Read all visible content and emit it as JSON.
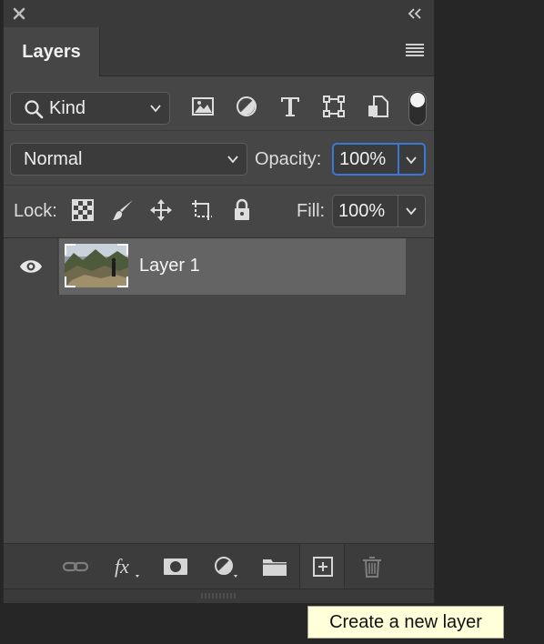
{
  "panel": {
    "tab_label": "Layers",
    "filter": {
      "kind_label": "Kind",
      "icons": [
        "image-filter-icon",
        "adjustment-filter-icon",
        "type-filter-icon",
        "shape-filter-icon",
        "smart-object-filter-icon"
      ]
    },
    "blend": {
      "mode": "Normal",
      "opacity_label": "Opacity:",
      "opacity_value": "100%"
    },
    "lock": {
      "label": "Lock:",
      "fill_label": "Fill:",
      "fill_value": "100%"
    },
    "layers": [
      {
        "name": "Layer 1",
        "visible": true
      }
    ],
    "bottom_icons": [
      "link-icon",
      "fx-icon",
      "mask-icon",
      "adjustment-icon",
      "folder-icon",
      "new-layer-icon",
      "trash-icon"
    ]
  },
  "tooltip": {
    "text": "Create a new layer"
  },
  "colors": {
    "panel_bg": "#464646",
    "selected_layer": "#646464",
    "focus_blue": "#3a78d6",
    "tooltip_bg": "#ffffd9"
  }
}
